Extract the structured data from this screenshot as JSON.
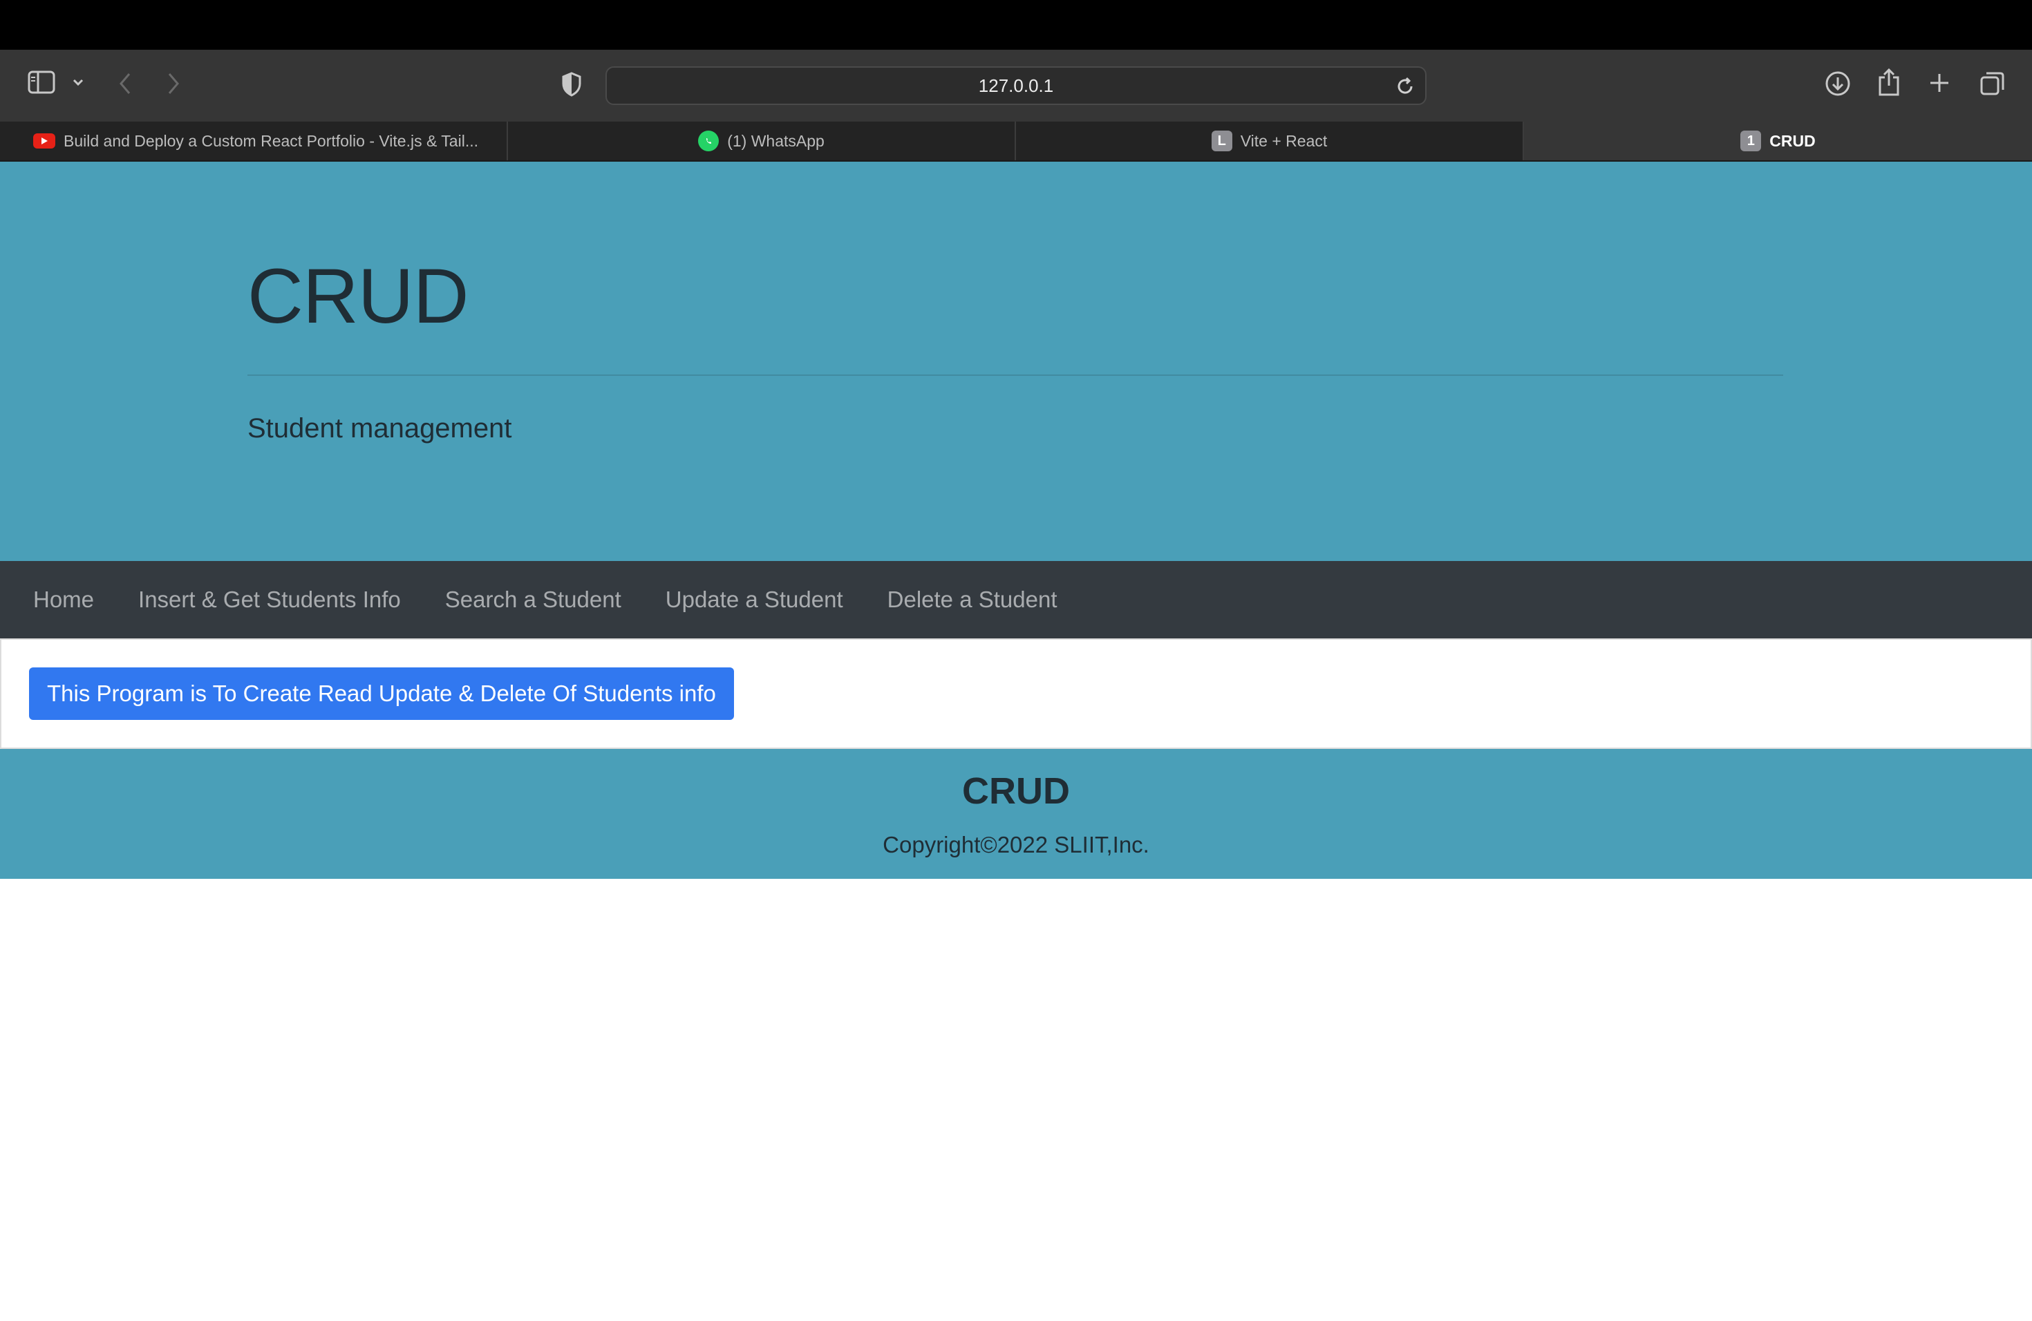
{
  "browser": {
    "url": "127.0.0.1",
    "tabs": [
      {
        "title": "Build and Deploy a Custom React Portfolio - Vite.js & Tail...",
        "favicon": "youtube-icon",
        "active": false
      },
      {
        "title": "(1) WhatsApp",
        "favicon": "whatsapp-icon",
        "active": false
      },
      {
        "title": "Vite + React",
        "favicon_letter": "L",
        "active": false
      },
      {
        "title": "CRUD",
        "favicon_letter": "1",
        "active": true
      }
    ]
  },
  "jumbotron": {
    "title": "CRUD",
    "subtitle": "Student management"
  },
  "navbar": {
    "links": [
      "Home",
      "Insert & Get Students Info",
      "Search a Student",
      "Update a Student",
      "Delete a Student"
    ]
  },
  "main": {
    "info_button_label": "This Program is To Create Read Update & Delete Of Students info"
  },
  "footer": {
    "title": "CRUD",
    "copyright": "Copyright©2022 SLIIT,Inc."
  },
  "colors": {
    "accent_teal": "#4a9fb8",
    "navbar_dark": "#343a40",
    "primary_blue": "#3178f0"
  }
}
